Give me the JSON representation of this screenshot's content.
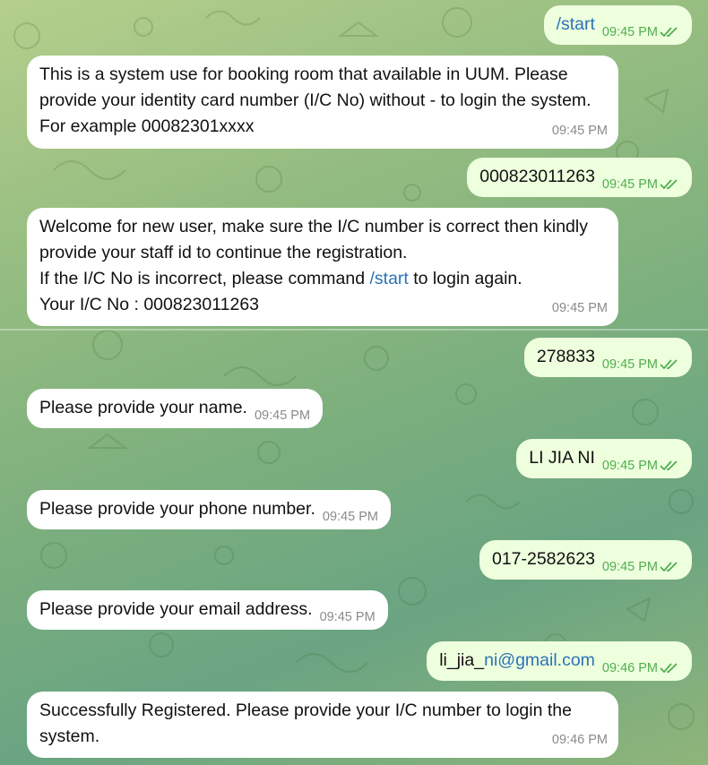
{
  "chat": {
    "messages": [
      {
        "dir": "out",
        "text": "/start",
        "time": "09:45 PM",
        "status": "read"
      },
      {
        "dir": "in",
        "text": "This is a system use for booking room that available in UUM. Please provide your identity card number (I/C No) without - to login the system. For example 00082301xxxx",
        "time": "09:45 PM"
      },
      {
        "dir": "out",
        "text": "000823011263",
        "time": "09:45 PM",
        "status": "read"
      },
      {
        "dir": "in",
        "text_a": "Welcome for new user, make sure the I/C number is correct then kindly provide your staff id to continue the registration.\nIf the I/C No is incorrect, please command ",
        "link": "/start",
        "text_b": " to login again.\nYour I/C No : 000823011263",
        "time": "09:45 PM"
      },
      {
        "dir": "out",
        "text": "278833",
        "time": "09:45 PM",
        "status": "read"
      },
      {
        "dir": "in",
        "text": "Please provide your name.",
        "time": "09:45 PM"
      },
      {
        "dir": "out",
        "text": "LI JIA NI",
        "time": "09:45 PM",
        "status": "read"
      },
      {
        "dir": "in",
        "text": "Please provide your phone number.",
        "time": "09:45 PM"
      },
      {
        "dir": "out",
        "text": "017-2582623",
        "time": "09:45 PM",
        "status": "read"
      },
      {
        "dir": "in",
        "text": "Please provide your email address.",
        "time": "09:45 PM"
      },
      {
        "dir": "out",
        "text_a": "li_jia_",
        "link": "ni@gmail.com",
        "time": "09:46 PM",
        "status": "read"
      },
      {
        "dir": "in",
        "text": "Successfully Registered. Please provide your I/C number to login the system.",
        "time": "09:46 PM"
      }
    ]
  },
  "colors": {
    "incoming_bubble": "#ffffff",
    "outgoing_bubble": "#eeffde",
    "outgoing_meta": "#4fae4e",
    "link": "#2a73b7"
  },
  "icons": {
    "read_status": "double-check-icon"
  }
}
